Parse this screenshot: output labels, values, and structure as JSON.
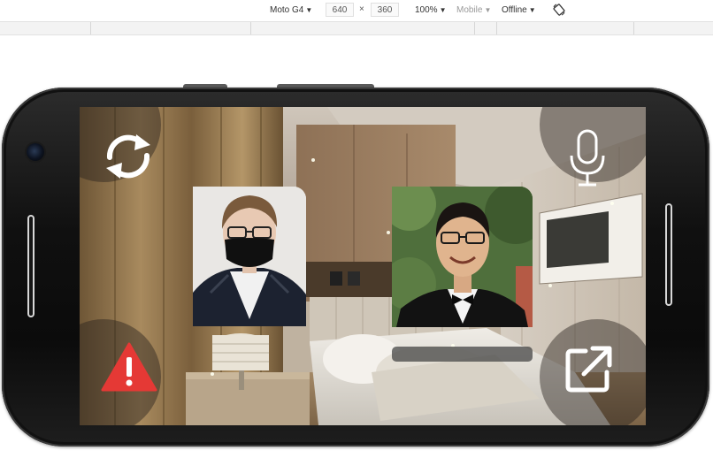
{
  "devtools_toolbar": {
    "device": "Moto G4",
    "width": "640",
    "height": "360",
    "times_symbol": "×",
    "zoom": "100%",
    "throttling": "Mobile",
    "network": "Offline",
    "dropdown_caret": "▼",
    "rotate_icon": "screen-rotate-icon"
  },
  "app": {
    "buttons": {
      "switch_camera": "refresh-sync-icon",
      "microphone": "microphone-icon",
      "report": "warning-triangle-icon",
      "share": "external-link-icon"
    },
    "participants": [
      {
        "id": "participant-1",
        "description_icon": "person-with-mask"
      },
      {
        "id": "participant-2",
        "description_icon": "person-in-tuxedo"
      }
    ],
    "colors": {
      "warning_red": "#e53935",
      "icon_white": "#ffffff",
      "button_overlay": "rgba(40,34,28,0.45)"
    }
  }
}
